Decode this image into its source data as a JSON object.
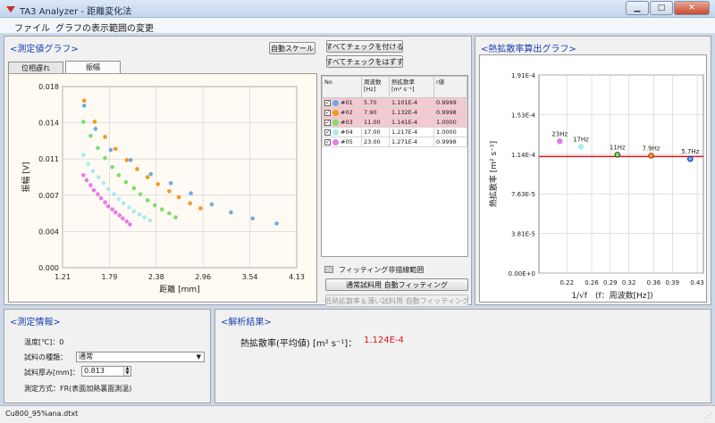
{
  "window": {
    "title": "TA3 Analyzer - 距離変化法"
  },
  "menu": {
    "file": "ファイル",
    "graph_range": "グラフの表示範囲の変更"
  },
  "measured_panel": {
    "title": "<測定値グラフ>",
    "auto_scale": "自動スケール",
    "check_all": "すべてチェックを付ける",
    "uncheck_all": "すべてチェックをはずす",
    "tabs": [
      "位相遅れ",
      "振幅"
    ],
    "active_tab": "振幅",
    "fit_legend": "フィッティング非描線範囲",
    "normal_fit": "通常試料用 自動フィッティング",
    "low_fit": "低熱拡散率＆薄い試料用 自動フィッティング"
  },
  "table": {
    "headers": {
      "no": "No",
      "freq": "周波数",
      "freq_unit": "[Hz]",
      "diff": "熱拡散率",
      "diff_unit": "[m² s⁻¹]",
      "r": "r値"
    },
    "rows": [
      {
        "id": "#01",
        "freq": "5.70",
        "diff": "1.101E-4",
        "r": "0.9999",
        "color": "#6aaee3",
        "checked": "✓",
        "hl": true
      },
      {
        "id": "#02",
        "freq": "7.90",
        "diff": "1.132E-4",
        "r": "0.9998",
        "color": "#f39a1f",
        "checked": "✓",
        "hl": true
      },
      {
        "id": "#03",
        "freq": "11.00",
        "diff": "1.141E-4",
        "r": "1.0000",
        "color": "#7ddf6a",
        "checked": "✓",
        "hl": true
      },
      {
        "id": "#04",
        "freq": "17.00",
        "diff": "1.217E-4",
        "r": "1.0000",
        "color": "#a9ecef",
        "checked": "✓",
        "hl": false
      },
      {
        "id": "#05",
        "freq": "23.00",
        "diff": "1.271E-4",
        "r": "0.9998",
        "color": "#e67ce6",
        "checked": "✓",
        "hl": false
      }
    ]
  },
  "diffusivity_panel": {
    "title": "<熱拡散率算出グラフ>"
  },
  "info_panel": {
    "title": "<測定情報>",
    "temp_label": "温度[℃]：",
    "temp_value": "0",
    "type_label": "試料の種類：",
    "type_value": "通常",
    "thick_label": "試料厚み[mm]：",
    "thick_value": "0.813",
    "method": "測定方式：FR(表面加熱裏面測温)"
  },
  "result_panel": {
    "title": "<解析結果>",
    "label": "熱拡散率(平均値) [m² s⁻¹]：",
    "value": "1.124E-4",
    "value_color": "#e0151b"
  },
  "status": {
    "file": "Cu800_95%ana.dtxt"
  },
  "colors": {
    "accent": "#1a3fb0",
    "fit_line": "#e0151b"
  },
  "chart_data": [
    {
      "type": "scatter",
      "xlabel": "距離 [mm]",
      "ylabel": "振幅 [V]",
      "xlim": [
        1.21,
        4.13
      ],
      "ylim": [
        0,
        0.018
      ],
      "xticks": [
        "1.21",
        "1.79",
        "2.38",
        "2.96",
        "3.54",
        "4.13"
      ],
      "yticks": [
        "0.000",
        "0.004",
        "0.007",
        "0.011",
        "0.014",
        "0.018"
      ],
      "series": [
        {
          "color": "#6aaee3",
          "x": [
            1.48,
            1.62,
            1.81,
            2.06,
            2.31,
            2.56,
            2.81,
            3.07,
            3.31,
            3.58,
            3.88
          ],
          "y": [
            0.0161,
            0.0138,
            0.0117,
            0.0107,
            0.0093,
            0.0084,
            0.0074,
            0.0063,
            0.0055,
            0.0049,
            0.0044
          ]
        },
        {
          "color": "#f39a1f",
          "x": [
            1.48,
            1.61,
            1.74,
            1.87,
            2.01,
            2.14,
            2.27,
            2.4,
            2.54,
            2.66,
            2.8,
            2.93
          ],
          "y": [
            0.0166,
            0.0145,
            0.013,
            0.0118,
            0.0107,
            0.0098,
            0.009,
            0.0083,
            0.0076,
            0.007,
            0.0064,
            0.0059
          ]
        },
        {
          "color": "#7ddf6a",
          "x": [
            1.47,
            1.56,
            1.65,
            1.74,
            1.83,
            1.91,
            2.0,
            2.1,
            2.18,
            2.27,
            2.36,
            2.45,
            2.54,
            2.62
          ],
          "y": [
            0.0145,
            0.0131,
            0.0119,
            0.0109,
            0.01,
            0.0092,
            0.0085,
            0.0079,
            0.0073,
            0.0067,
            0.0062,
            0.0058,
            0.0054,
            0.005
          ]
        },
        {
          "color": "#a9ecef",
          "x": [
            1.47,
            1.53,
            1.59,
            1.66,
            1.72,
            1.78,
            1.85,
            1.91,
            1.97,
            2.04,
            2.1,
            2.17,
            2.23,
            2.3
          ],
          "y": [
            0.0112,
            0.0103,
            0.0096,
            0.009,
            0.0084,
            0.0078,
            0.0073,
            0.0068,
            0.0064,
            0.006,
            0.0056,
            0.0053,
            0.005,
            0.0047
          ]
        },
        {
          "color": "#e67ce6",
          "x": [
            1.47,
            1.51,
            1.56,
            1.6,
            1.65,
            1.69,
            1.74,
            1.78,
            1.83,
            1.87,
            1.92,
            1.96,
            2.01,
            2.05
          ],
          "y": [
            0.0092,
            0.0087,
            0.0082,
            0.0077,
            0.0073,
            0.0069,
            0.0065,
            0.0061,
            0.0058,
            0.0055,
            0.0052,
            0.0049,
            0.0046,
            0.0043
          ]
        }
      ]
    },
    {
      "type": "scatter",
      "xlabel": "1/√f　(f：周波数[Hz])",
      "ylabel": "熱拡散率 [m² s⁻¹]",
      "xlim": [
        0.175,
        0.44
      ],
      "ylim": [
        0,
        0.000191
      ],
      "xticks": [
        "0.22",
        "0.26",
        "0.29",
        "0.32",
        "0.36",
        "0.39",
        "0.43"
      ],
      "xtick_values": [
        0.22,
        0.26,
        0.29,
        0.32,
        0.36,
        0.39,
        0.43
      ],
      "yticks": [
        "0.00E+0",
        "3.81E-5",
        "7.63E-5",
        "1.14E-4",
        "1.53E-4",
        "1.91E-4"
      ],
      "fit_value": 0.0001124,
      "points": [
        {
          "label": "23Hz",
          "x": 0.2085,
          "y": 0.0001271,
          "color": "#e67ce6",
          "ring": "#e67ce6"
        },
        {
          "label": "17Hz",
          "x": 0.2425,
          "y": 0.0001217,
          "color": "#a9ecef",
          "ring": "#a9ecef"
        },
        {
          "label": "11Hz",
          "x": 0.3015,
          "y": 0.0001141,
          "color": "#7ddf6a",
          "ring": "#2b4a16"
        },
        {
          "label": "7.9Hz",
          "x": 0.3558,
          "y": 0.0001132,
          "color": "#f39a1f",
          "ring": "#8a3b0c"
        },
        {
          "label": "5.7Hz",
          "x": 0.4189,
          "y": 0.0001101,
          "color": "#6aaee3",
          "ring": "#1426a8"
        }
      ]
    }
  ]
}
